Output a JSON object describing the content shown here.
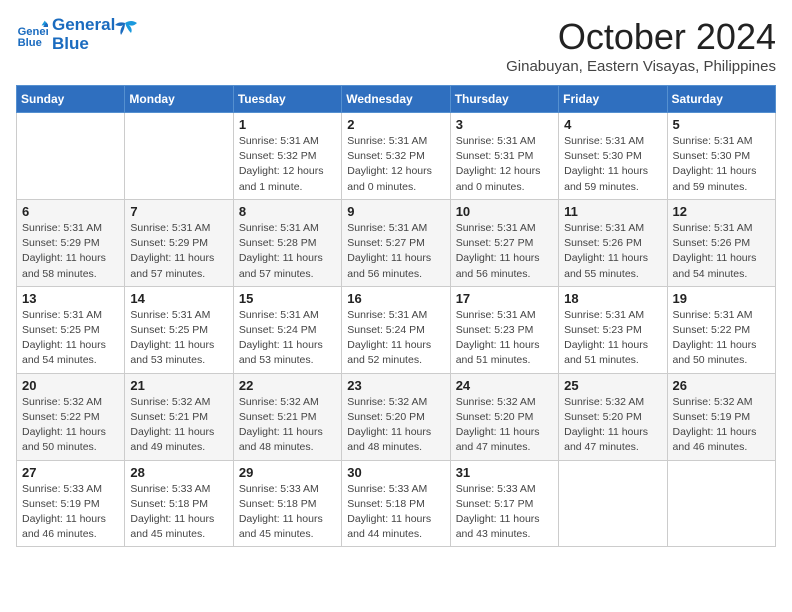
{
  "logo": {
    "line1": "General",
    "line2": "Blue"
  },
  "title": "October 2024",
  "location": "Ginabuyan, Eastern Visayas, Philippines",
  "days_of_week": [
    "Sunday",
    "Monday",
    "Tuesday",
    "Wednesday",
    "Thursday",
    "Friday",
    "Saturday"
  ],
  "weeks": [
    [
      {
        "day": "",
        "detail": ""
      },
      {
        "day": "",
        "detail": ""
      },
      {
        "day": "1",
        "detail": "Sunrise: 5:31 AM\nSunset: 5:32 PM\nDaylight: 12 hours\nand 1 minute."
      },
      {
        "day": "2",
        "detail": "Sunrise: 5:31 AM\nSunset: 5:32 PM\nDaylight: 12 hours\nand 0 minutes."
      },
      {
        "day": "3",
        "detail": "Sunrise: 5:31 AM\nSunset: 5:31 PM\nDaylight: 12 hours\nand 0 minutes."
      },
      {
        "day": "4",
        "detail": "Sunrise: 5:31 AM\nSunset: 5:30 PM\nDaylight: 11 hours\nand 59 minutes."
      },
      {
        "day": "5",
        "detail": "Sunrise: 5:31 AM\nSunset: 5:30 PM\nDaylight: 11 hours\nand 59 minutes."
      }
    ],
    [
      {
        "day": "6",
        "detail": "Sunrise: 5:31 AM\nSunset: 5:29 PM\nDaylight: 11 hours\nand 58 minutes."
      },
      {
        "day": "7",
        "detail": "Sunrise: 5:31 AM\nSunset: 5:29 PM\nDaylight: 11 hours\nand 57 minutes."
      },
      {
        "day": "8",
        "detail": "Sunrise: 5:31 AM\nSunset: 5:28 PM\nDaylight: 11 hours\nand 57 minutes."
      },
      {
        "day": "9",
        "detail": "Sunrise: 5:31 AM\nSunset: 5:27 PM\nDaylight: 11 hours\nand 56 minutes."
      },
      {
        "day": "10",
        "detail": "Sunrise: 5:31 AM\nSunset: 5:27 PM\nDaylight: 11 hours\nand 56 minutes."
      },
      {
        "day": "11",
        "detail": "Sunrise: 5:31 AM\nSunset: 5:26 PM\nDaylight: 11 hours\nand 55 minutes."
      },
      {
        "day": "12",
        "detail": "Sunrise: 5:31 AM\nSunset: 5:26 PM\nDaylight: 11 hours\nand 54 minutes."
      }
    ],
    [
      {
        "day": "13",
        "detail": "Sunrise: 5:31 AM\nSunset: 5:25 PM\nDaylight: 11 hours\nand 54 minutes."
      },
      {
        "day": "14",
        "detail": "Sunrise: 5:31 AM\nSunset: 5:25 PM\nDaylight: 11 hours\nand 53 minutes."
      },
      {
        "day": "15",
        "detail": "Sunrise: 5:31 AM\nSunset: 5:24 PM\nDaylight: 11 hours\nand 53 minutes."
      },
      {
        "day": "16",
        "detail": "Sunrise: 5:31 AM\nSunset: 5:24 PM\nDaylight: 11 hours\nand 52 minutes."
      },
      {
        "day": "17",
        "detail": "Sunrise: 5:31 AM\nSunset: 5:23 PM\nDaylight: 11 hours\nand 51 minutes."
      },
      {
        "day": "18",
        "detail": "Sunrise: 5:31 AM\nSunset: 5:23 PM\nDaylight: 11 hours\nand 51 minutes."
      },
      {
        "day": "19",
        "detail": "Sunrise: 5:31 AM\nSunset: 5:22 PM\nDaylight: 11 hours\nand 50 minutes."
      }
    ],
    [
      {
        "day": "20",
        "detail": "Sunrise: 5:32 AM\nSunset: 5:22 PM\nDaylight: 11 hours\nand 50 minutes."
      },
      {
        "day": "21",
        "detail": "Sunrise: 5:32 AM\nSunset: 5:21 PM\nDaylight: 11 hours\nand 49 minutes."
      },
      {
        "day": "22",
        "detail": "Sunrise: 5:32 AM\nSunset: 5:21 PM\nDaylight: 11 hours\nand 48 minutes."
      },
      {
        "day": "23",
        "detail": "Sunrise: 5:32 AM\nSunset: 5:20 PM\nDaylight: 11 hours\nand 48 minutes."
      },
      {
        "day": "24",
        "detail": "Sunrise: 5:32 AM\nSunset: 5:20 PM\nDaylight: 11 hours\nand 47 minutes."
      },
      {
        "day": "25",
        "detail": "Sunrise: 5:32 AM\nSunset: 5:20 PM\nDaylight: 11 hours\nand 47 minutes."
      },
      {
        "day": "26",
        "detail": "Sunrise: 5:32 AM\nSunset: 5:19 PM\nDaylight: 11 hours\nand 46 minutes."
      }
    ],
    [
      {
        "day": "27",
        "detail": "Sunrise: 5:33 AM\nSunset: 5:19 PM\nDaylight: 11 hours\nand 46 minutes."
      },
      {
        "day": "28",
        "detail": "Sunrise: 5:33 AM\nSunset: 5:18 PM\nDaylight: 11 hours\nand 45 minutes."
      },
      {
        "day": "29",
        "detail": "Sunrise: 5:33 AM\nSunset: 5:18 PM\nDaylight: 11 hours\nand 45 minutes."
      },
      {
        "day": "30",
        "detail": "Sunrise: 5:33 AM\nSunset: 5:18 PM\nDaylight: 11 hours\nand 44 minutes."
      },
      {
        "day": "31",
        "detail": "Sunrise: 5:33 AM\nSunset: 5:17 PM\nDaylight: 11 hours\nand 43 minutes."
      },
      {
        "day": "",
        "detail": ""
      },
      {
        "day": "",
        "detail": ""
      }
    ]
  ]
}
